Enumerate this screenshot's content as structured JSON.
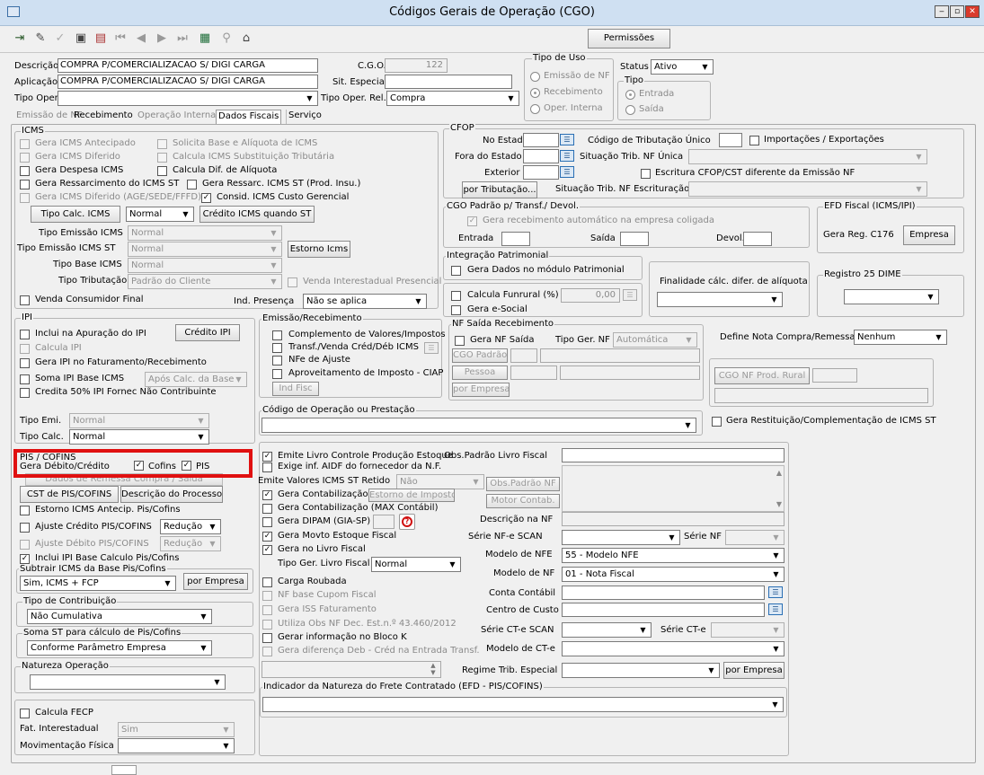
{
  "window": {
    "title": "Códigos Gerais de Operação (CGO)",
    "minimize": "‒",
    "maximize": "▫",
    "close": "✕"
  },
  "toolbar": {
    "icons": [
      "exit-icon",
      "edit-icon",
      "approve-icon",
      "save-icon",
      "print-icon",
      "first-icon",
      "prev-icon",
      "next-icon",
      "last-icon",
      "grid-icon",
      "binoculars-icon",
      "export-icon"
    ],
    "permissions": "Permissões"
  },
  "header": {
    "descricao_label": "Descrição",
    "descricao": "COMPRA P/COMERCIALIZACAO S/ DIGI CARGA",
    "aplicacao_label": "Aplicação",
    "aplicacao": "COMPRA P/COMERCIALIZACAO S/ DIGI CARGA",
    "tipo_oper_label": "Tipo Oper.",
    "tipo_oper": "",
    "cgo_label": "C.G.O.",
    "cgo": "122",
    "sit_especial_label": "Sit. Especial",
    "sit_especial": "",
    "tipo_oper_rel_label": "Tipo Oper. Rel.",
    "tipo_oper_rel": "Compra",
    "tipo_uso_title": "Tipo de Uso",
    "tipo_uso": [
      "Emissão de NF",
      "Recebimento",
      "Oper. Interna"
    ],
    "status_label": "Status",
    "status": "Ativo",
    "tipo_title": "Tipo",
    "tipo": [
      "Entrada",
      "Saída"
    ]
  },
  "tabs": [
    "Emissão de NF",
    "Recebimento",
    "Operação Interna",
    "Dados Fiscais",
    "Serviço"
  ],
  "icms": {
    "title": "ICMS",
    "checks": [
      "Gera ICMS Antecipado",
      "Solicita Base e Alíquota de ICMS",
      "Gera ICMS Diferido",
      "Calcula ICMS Substituição Tributária",
      "Gera Despesa ICMS",
      "Calcula Dif. de Alíquota",
      "Gera Ressarcimento do ICMS ST",
      "Gera Ressarc. ICMS ST (Prod. Insu.)",
      "Gera ICMS Diferido (AGE/SEDE/FFFD)",
      "Consid. ICMS Custo Gerencial"
    ],
    "tipo_calc_btn": "Tipo Calc. ICMS",
    "tipo_calc": "Normal",
    "credito_btn": "Crédito ICMS quando ST",
    "tipo_emissao_label": "Tipo Emissão ICMS",
    "tipo_emissao": "Normal",
    "tipo_emissao_st_label": "Tipo Emissão ICMS ST",
    "tipo_emissao_st": "Normal",
    "estorno_btn": "Estorno Icms",
    "tipo_base_label": "Tipo Base ICMS",
    "tipo_base": "Normal",
    "tipo_trib_label": "Tipo Tributação",
    "tipo_trib": "Padrão do Cliente",
    "venda_inter": "Venda Interestadual Presencial",
    "venda_cons": "Venda Consumidor Final",
    "ind_presenca_label": "Ind. Presença",
    "ind_presenca": "Não se aplica"
  },
  "ipi": {
    "title": "IPI",
    "checks": [
      "Inclui na Apuração do IPI",
      "Calcula IPI",
      "Gera IPI no Faturamento/Recebimento",
      "Soma IPI Base ICMS",
      "Credita 50% IPI Fornec Não Contribuinte"
    ],
    "credito_btn": "Crédito IPI",
    "soma_sel": "Após Calc. da Base",
    "tipo_emi_label": "Tipo Emi.",
    "tipo_emi": "Normal",
    "tipo_calc_label": "Tipo Calc.",
    "tipo_calc": "Normal"
  },
  "pis": {
    "title": "PIS / COFINS",
    "gera_label": "Gera Débito/Crédito",
    "cofins": "Cofins",
    "pis": "PIS",
    "dados_remessa": "Dados de Remessa Compra / Saída",
    "cst_btn": "CST de PIS/COFINS",
    "desc_btn": "Descrição do Processo",
    "estorno": "Estorno ICMS Antecip. Pis/Cofins",
    "ajuste_cred": "Ajuste Crédito PIS/COFINS",
    "ajuste_cred_sel": "Redução",
    "ajuste_deb": "Ajuste Débito PIS/COFINS",
    "ajuste_deb_sel": "Redução",
    "inclui_ipi": "Inclui IPI Base Calculo Pis/Cofins",
    "subtrair_title": "Subtrair ICMS da Base Pis/Cofins",
    "subtrair": "Sim, ICMS + FCP",
    "por_empresa": "por Empresa",
    "tipo_contrib_title": "Tipo de Contribuição",
    "tipo_contrib": "Não Cumulativa",
    "soma_st_title": "Soma ST para cálculo de Pis/Cofins",
    "soma_st": "Conforme Parâmetro Empresa"
  },
  "natureza": {
    "title": "Natureza Operação",
    "value": ""
  },
  "fecp": {
    "calcula": "Calcula FECP",
    "fat_label": "Fat. Interestadual",
    "fat": "Sim",
    "mov_label": "Movimentação Física",
    "mov": ""
  },
  "cfop": {
    "title": "CFOP",
    "no_estado": "No Estado",
    "fora_estado": "Fora do Estado",
    "exterior": "Exterior",
    "cod_trib_unico": "Código de Tributação Único",
    "importacoes": "Importações / Exportações",
    "sit_trib_nf_unica": "Situação Trib. NF Única",
    "escritura": "Escritura CFOP/CST diferente da Emissão NF",
    "por_trib_btn": "por Tributação...",
    "sit_trib_escr": "Situação Trib. NF Escrituração"
  },
  "cgo_padrao": {
    "title": "CGO Padrão p/ Transf./ Devol.",
    "gera_receb": "Gera recebimento automático na empresa coligada",
    "entrada": "Entrada",
    "saida": "Saída",
    "devol": "Devol."
  },
  "efd": {
    "title": "EFD Fiscal (ICMS/IPI)",
    "gera_reg": "Gera Reg. C176",
    "empresa_btn": "Empresa"
  },
  "patrimonial": {
    "title": "Integração Patrimonial",
    "gera": "Gera Dados no módulo Patrimonial"
  },
  "funrural": {
    "calcula": "Calcula Funrural (%)",
    "valor": "0,00",
    "gera_esocial": "Gera e-Social"
  },
  "finalidade": "Finalidade cálc. difer. de alíquota",
  "dime": {
    "title": "Registro 25 DIME"
  },
  "emissao": {
    "title": "Emissão/Recebimento",
    "checks": [
      "Complemento de Valores/Impostos",
      "Transf./Venda Créd/Déb ICMS",
      "NFe de Ajuste",
      "Aproveitamento de Imposto - CIAP"
    ],
    "ind_fisc": "Ind Fisc"
  },
  "nf_saida": {
    "title": "NF Saída Recebimento",
    "gera": "Gera NF Saída",
    "tipo_ger_label": "Tipo Ger. NF",
    "tipo_ger": "Automática",
    "cgo_padrao_btn": "CGO Padrão",
    "pessoa_btn": "Pessoa",
    "por_empresa_btn": "por Empresa"
  },
  "define_nota": {
    "label": "Define Nota Compra/Remessa",
    "value": "Nenhum",
    "cgo_rural_btn": "CGO NF Prod. Rural"
  },
  "cod_oper": {
    "title": "Código de Operação ou Prestação",
    "gera_rest": "Gera Restituição/Complementação de ICMS ST"
  },
  "bottom": {
    "emite_livro": "Emite Livro Controle Produção Estoque",
    "exige_aidf": "Exige inf. AIDF do fornecedor da N.F.",
    "emite_valores": "Emite Valores ICMS ST Retido",
    "emite_valores_sel": "Não",
    "gera_contab": "Gera Contabilização",
    "estorno_imp_btn": "Estorno de Impostos",
    "gera_contab_max": "Gera Contabilização (MAX Contábil)",
    "gera_dipam": "Gera DIPAM (GIA-SP)",
    "gera_movto": "Gera Movto Estoque Fiscal",
    "gera_livro": "Gera no Livro Fiscal",
    "tipo_ger_livro_label": "Tipo Ger. Livro Fiscal",
    "tipo_ger_livro": "Normal",
    "carga_roubada": "Carga Roubada",
    "nf_cupom": "NF base Cupom Fiscal",
    "gera_iss": "Gera ISS Faturamento",
    "utiliza_obs": "Utiliza Obs NF Dec. Est.n.º 43.460/2012",
    "gerar_bloco_k": "Gerar informação no Bloco K",
    "gera_dif": "Gera diferença Deb - Créd na Entrada Transf.",
    "obs_padrao_label": "Obs.Padrão Livro Fiscal",
    "obs_padrao_btn": "Obs.Padrão NF",
    "motor_btn": "Motor Contab.",
    "descricao_nf": "Descrição na NF",
    "serie_scan": "Série NF-e SCAN",
    "serie_nf": "Série NF",
    "modelo_nfe_label": "Modelo de NFE",
    "modelo_nfe": "55 - Modelo NFE",
    "modelo_nf_label": "Modelo de NF",
    "modelo_nf": "01 - Nota Fiscal",
    "conta_contabil": "Conta Contábil",
    "centro_custo": "Centro de Custo",
    "serie_cte_scan": "Série CT-e SCAN",
    "serie_cte": "Série CT-e",
    "modelo_cte": "Modelo de CT-e",
    "regime": "Regime Trib. Especial",
    "por_empresa": "por Empresa",
    "indicador_title": "Indicador da Natureza do Frete Contratado (EFD - PIS/COFINS)"
  }
}
